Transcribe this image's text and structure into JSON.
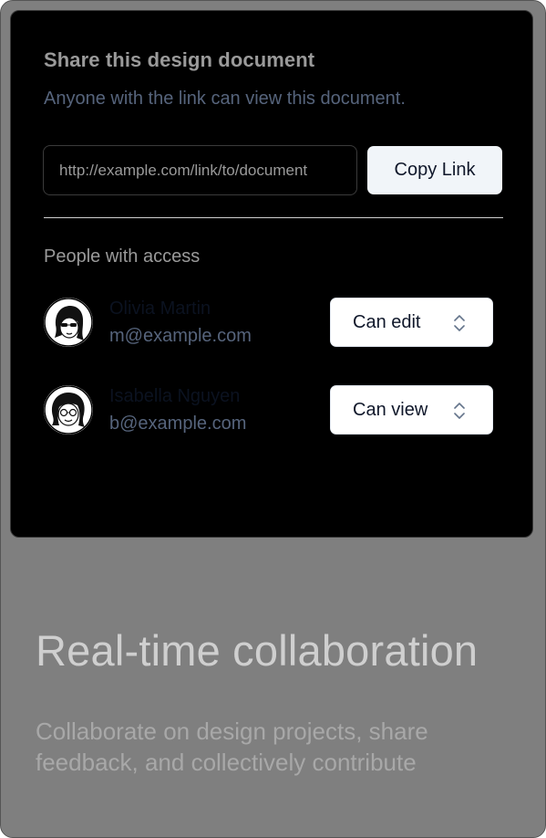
{
  "share": {
    "title": "Share this design document",
    "subtitle": "Anyone with the link can view this document.",
    "link_value": "http://example.com/link/to/document",
    "copy_label": "Copy Link"
  },
  "access": {
    "heading": "People with access",
    "people": [
      {
        "name": "Olivia Martin",
        "email": "m@example.com",
        "role": "Can edit",
        "avatar_icon": "avatar-illustration-sunglasses"
      },
      {
        "name": "Isabella Nguyen",
        "email": "b@example.com",
        "role": "Can view",
        "avatar_icon": "avatar-illustration-glasses"
      }
    ]
  },
  "feature": {
    "title": "Real-time collaboration",
    "description": "Collaborate on design projects, share feedback, and collectively contribute"
  },
  "icons": {
    "role_select": "chevron-up-down-icon"
  },
  "colors": {
    "card_bg": "#7f7f7f",
    "panel_bg": "#000000",
    "button_bg": "#f1f5f9",
    "muted_text": "#56647c"
  }
}
